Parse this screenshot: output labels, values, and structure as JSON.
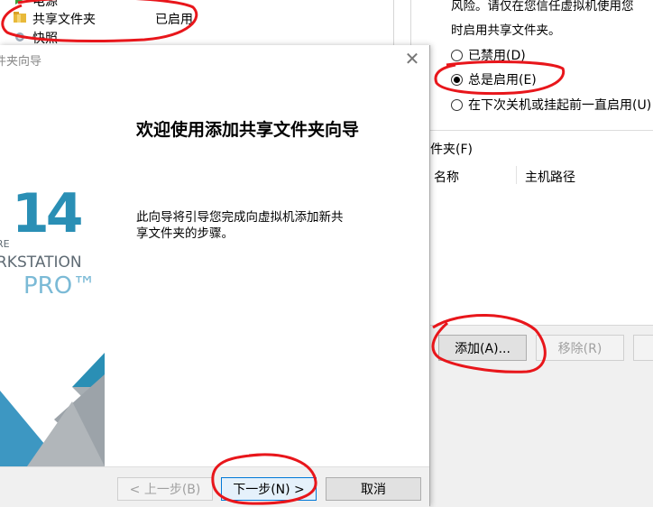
{
  "settings_list": {
    "items": [
      {
        "label": "电源",
        "icon": "power-icon",
        "value": ""
      },
      {
        "label": "共享文件夹",
        "icon": "folder-icon",
        "value": "已启用"
      },
      {
        "label": "快照",
        "icon": "snapshot-icon",
        "value": ""
      }
    ]
  },
  "right_panel": {
    "warning_lines": [
      "风险。请仅在您信任虚拟机使用您",
      "时启用共享文件夹。"
    ],
    "radio_options": [
      {
        "label": "已禁用(D)",
        "checked": false
      },
      {
        "label": "总是启用(E)",
        "checked": true
      },
      {
        "label": "在下次关机或挂起前一直启用(U)",
        "checked": false
      }
    ],
    "folders_label": "件夹(F)",
    "table_headers": [
      "名称",
      "主机路径"
    ],
    "add_button": "添加(A)...",
    "remove_button": "移除(R)"
  },
  "wizard": {
    "title": "件夹向导",
    "heading": "欢迎使用添加共享文件夹向导",
    "description_lines": [
      "此向导将引导您完成向虚拟机添加新共",
      "享文件夹的步骤。"
    ],
    "brand": {
      "version": "14",
      "line1": "RE",
      "line2": "RKSTATION",
      "edition": "PRO™"
    },
    "buttons": {
      "back": "< 上一步(B)",
      "next": "下一步(N) >",
      "cancel": "取消"
    }
  },
  "colors": {
    "annotation": "#e8161b",
    "brand_blue": "#2a8fb5",
    "edition_blue": "#7bbad6"
  }
}
